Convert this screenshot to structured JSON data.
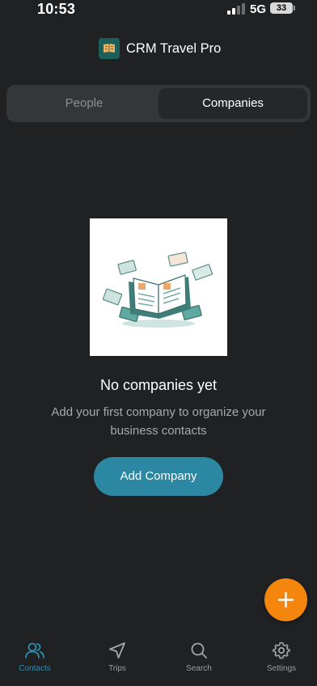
{
  "status_bar": {
    "time": "10:53",
    "network": "5G",
    "battery": "33"
  },
  "header": {
    "title": "CRM Travel Pro",
    "logo_icon": "app-logo-icon"
  },
  "segment": {
    "tabs": [
      "People",
      "Companies"
    ],
    "selected": "Companies"
  },
  "empty_state": {
    "title": "No companies yet",
    "description": "Add your first company to organize your business contacts",
    "button_label": "Add Company",
    "illustration_icon": "address-book-illustration"
  },
  "fab": {
    "icon": "plus-icon"
  },
  "bottom_nav": {
    "items": [
      {
        "label": "Contacts",
        "icon": "users-icon",
        "active": true
      },
      {
        "label": "Trips",
        "icon": "navigation-arrow-icon",
        "active": false
      },
      {
        "label": "Search",
        "icon": "search-icon",
        "active": false
      },
      {
        "label": "Settings",
        "icon": "gear-icon",
        "active": false
      }
    ]
  },
  "colors": {
    "background": "#1f2123",
    "accent": "#2c87a2",
    "fab": "#f5860d",
    "active_nav": "#2e8cb0"
  }
}
